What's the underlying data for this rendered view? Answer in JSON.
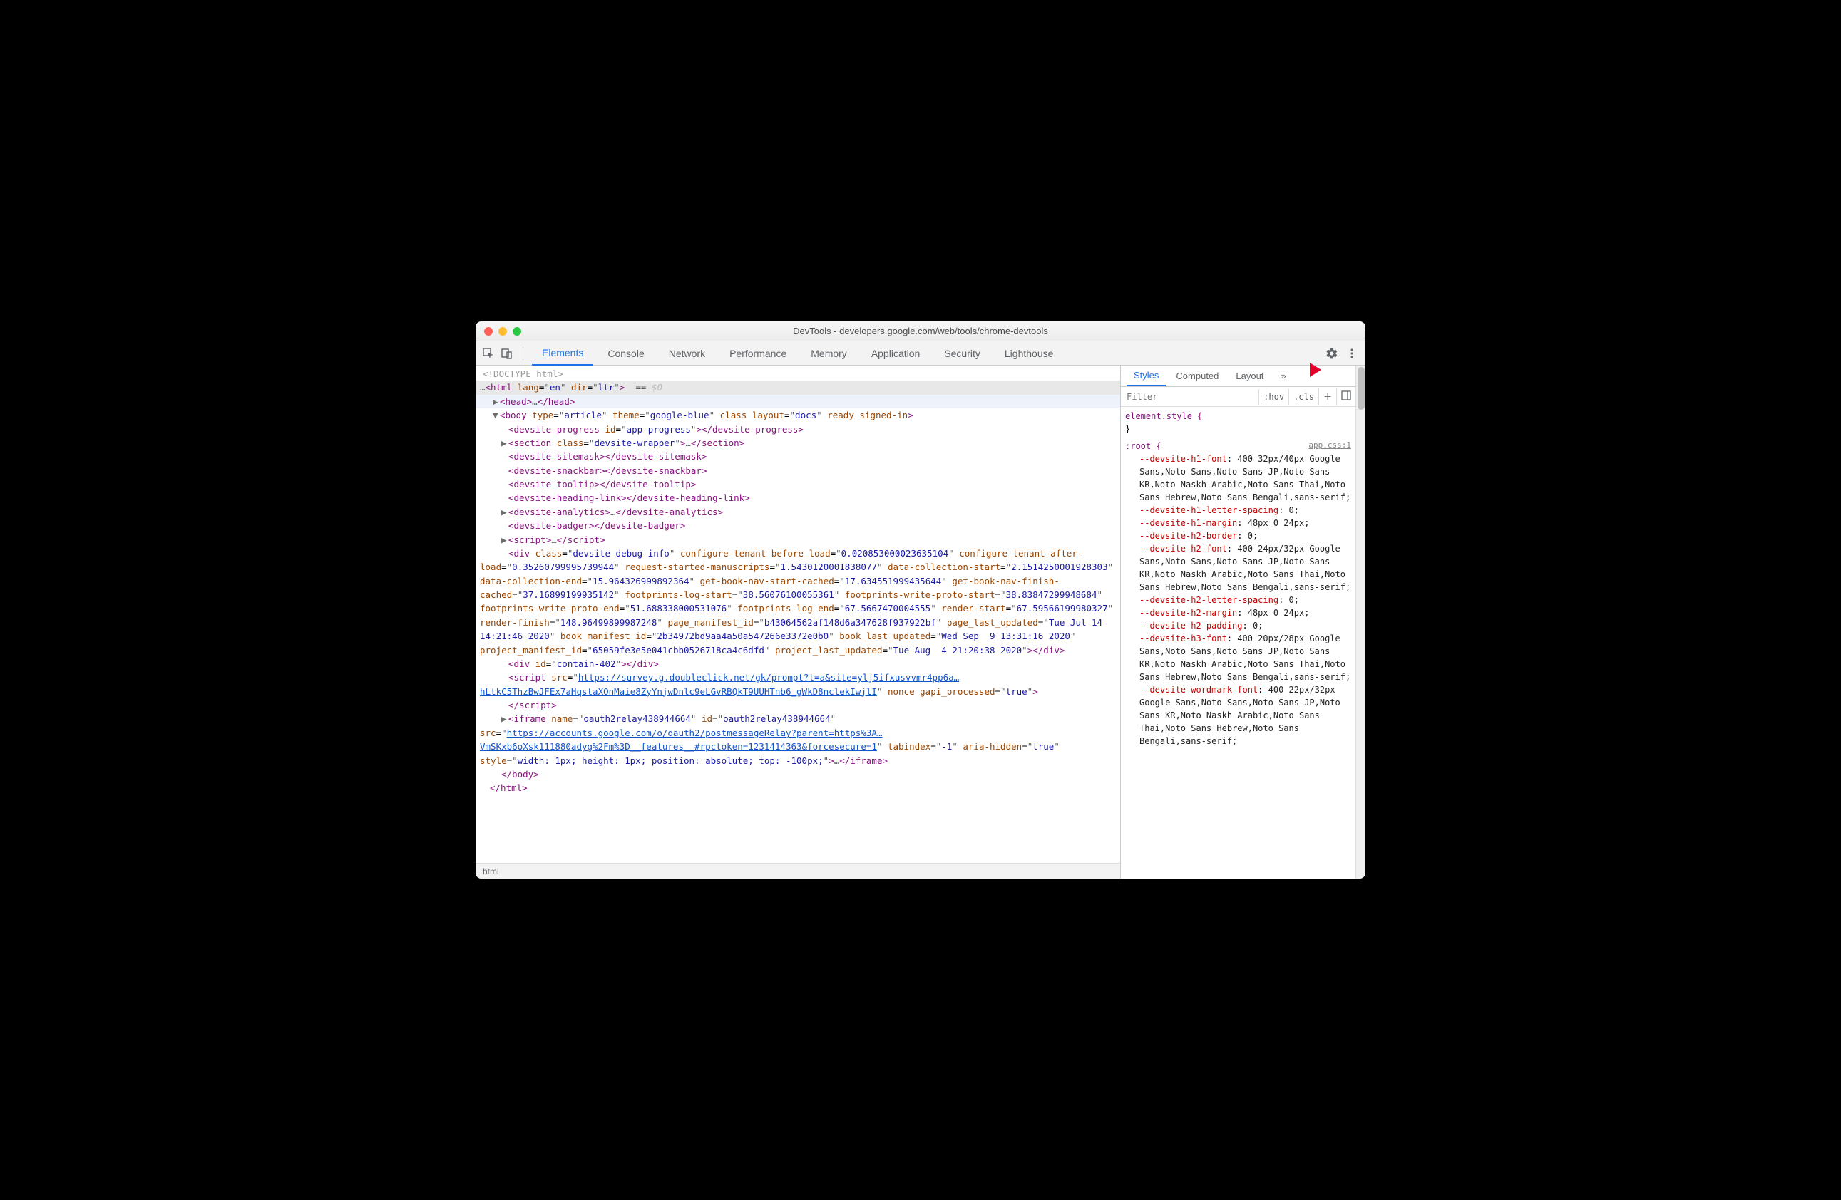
{
  "window": {
    "title": "DevTools - developers.google.com/web/tools/chrome-devtools"
  },
  "tabs": [
    "Elements",
    "Console",
    "Network",
    "Performance",
    "Memory",
    "Application",
    "Security",
    "Lighthouse"
  ],
  "activeTab": "Elements",
  "stylesTabs": [
    "Styles",
    "Computed",
    "Layout"
  ],
  "activeStylesTab": "Styles",
  "filterPlaceholder": "Filter",
  "hov": ":hov",
  "cls": ".cls",
  "breadcrumb": "html",
  "dom": {
    "doctype": "<!DOCTYPE html>",
    "htmlOpen": {
      "pre": "…",
      "tag": "html",
      "attrs": [
        [
          "lang",
          "en"
        ],
        [
          "dir",
          "ltr"
        ]
      ],
      "after": " == ",
      "dollar": "$0"
    },
    "head": {
      "open": "head",
      "ellipsis": "…",
      "close": "head"
    },
    "bodyOpen": {
      "tag": "body",
      "attrs": [
        [
          "type",
          "article"
        ],
        [
          "theme",
          "google-blue"
        ],
        [
          "class",
          ""
        ],
        [
          "layout",
          "docs"
        ],
        [
          "ready",
          ""
        ],
        [
          "signed-in",
          ""
        ]
      ]
    },
    "devsiteProgress": {
      "tag": "devsite-progress",
      "attrs": [
        [
          "id",
          "app-progress"
        ]
      ]
    },
    "sectionWrapper": {
      "tag": "section",
      "attrs": [
        [
          "class",
          "devsite-wrapper"
        ]
      ],
      "ellipsis": "…"
    },
    "sitemask": "devsite-sitemask",
    "snackbar": "devsite-snackbar",
    "tooltip": "devsite-tooltip",
    "headingLink": "devsite-heading-link",
    "analytics": {
      "tag": "devsite-analytics",
      "ellipsis": "…"
    },
    "badger": "devsite-badger",
    "script1": {
      "tag": "script",
      "ellipsis": "…"
    },
    "debugDiv": {
      "tag": "div",
      "attrs": [
        [
          "class",
          "devsite-debug-info"
        ],
        [
          "configure-tenant-before-load",
          "0.020853000023635104"
        ],
        [
          "configure-tenant-after-load",
          "0.35260799995739944"
        ],
        [
          "request-started-manuscripts",
          "1.5430120001838077"
        ],
        [
          "data-collection-start",
          "2.1514250001928303"
        ],
        [
          "data-collection-end",
          "15.964326999892364"
        ],
        [
          "get-book-nav-start-cached",
          "17.634551999435644"
        ],
        [
          "get-book-nav-finish-cached",
          "37.16899199935142"
        ],
        [
          "footprints-log-start",
          "38.56076100055361"
        ],
        [
          "footprints-write-proto-start",
          "38.83847299948684"
        ],
        [
          "footprints-write-proto-end",
          "51.688338000531076"
        ],
        [
          "footprints-log-end",
          "67.5667470004555"
        ],
        [
          "render-start",
          "67.59566199980327"
        ],
        [
          "render-finish",
          "148.96499899987248"
        ],
        [
          "page_manifest_id",
          "b43064562af148d6a347628f937922bf"
        ],
        [
          "page_last_updated",
          "Tue Jul 14 14:21:46 2020"
        ],
        [
          "book_manifest_id",
          "2b34972bd9aa4a50a547266e3372e0b0"
        ],
        [
          "book_last_updated",
          "Wed Sep  9 13:31:16 2020"
        ],
        [
          "project_manifest_id",
          "65059fe3e5e041cbb0526718ca4c6dfd"
        ],
        [
          "project_last_updated",
          "Tue Aug  4 21:20:38 2020"
        ]
      ]
    },
    "contain402": {
      "tag": "div",
      "attrs": [
        [
          "id",
          "contain-402"
        ]
      ]
    },
    "surveyScript": {
      "tag": "script",
      "src": "https://survey.g.doubleclick.net/gk/prompt?t=a&site=ylj5ifxusvvmr4pp6a…hLtkC5ThzBwJFEx7aHqstaXOnMaie8ZyYnjwDnlc9eLGvRBQkT9UUHTnb6_gWkD8nclekIwjlI",
      "attrs_after": [
        [
          "nonce",
          ""
        ],
        [
          "gapi_processed",
          "true"
        ]
      ]
    },
    "iframe": {
      "tag": "iframe",
      "attrs": [
        [
          "name",
          "oauth2relay438944664"
        ],
        [
          "id",
          "oauth2relay438944664"
        ]
      ],
      "src": "https://accounts.google.com/o/oauth2/postmessageRelay?parent=https%3A…VmSKxb6oXsk111880adyg%2Fm%3D__features__#rpctoken=1231414363&forcesecure=1",
      "attrs_after": [
        [
          "tabindex",
          "-1"
        ],
        [
          "aria-hidden",
          "true"
        ],
        [
          "style",
          "width: 1px; height: 1px; position: absolute; top: -100px;"
        ]
      ],
      "ellipsis": "…"
    },
    "bodyClose": "body",
    "htmlClose": "html"
  },
  "styles": {
    "elementStyle": "element.style {",
    "elementStyleClose": "}",
    "rootSelector": ":root {",
    "sourceLink": "app.css:1",
    "props": [
      {
        "name": "--devsite-h1-font",
        "value": "400 32px/40px Google Sans,Noto Sans,Noto Sans JP,Noto Sans KR,Noto Naskh Arabic,Noto Sans Thai,Noto Sans Hebrew,Noto Sans Bengali,sans-serif;"
      },
      {
        "name": "--devsite-h1-letter-spacing",
        "value": "0;"
      },
      {
        "name": "--devsite-h1-margin",
        "value": "48px 0 24px;"
      },
      {
        "name": "--devsite-h2-border",
        "value": "0;"
      },
      {
        "name": "--devsite-h2-font",
        "value": "400 24px/32px Google Sans,Noto Sans,Noto Sans JP,Noto Sans KR,Noto Naskh Arabic,Noto Sans Thai,Noto Sans Hebrew,Noto Sans Bengali,sans-serif;"
      },
      {
        "name": "--devsite-h2-letter-spacing",
        "value": "0;"
      },
      {
        "name": "--devsite-h2-margin",
        "value": "48px 0 24px;"
      },
      {
        "name": "--devsite-h2-padding",
        "value": "0;"
      },
      {
        "name": "--devsite-h3-font",
        "value": "400 20px/28px Google Sans,Noto Sans,Noto Sans JP,Noto Sans KR,Noto Naskh Arabic,Noto Sans Thai,Noto Sans Hebrew,Noto Sans Bengali,sans-serif;"
      },
      {
        "name": "--devsite-wordmark-font",
        "value": "400 22px/32px Google Sans,Noto Sans,Noto Sans JP,Noto Sans KR,Noto Naskh Arabic,Noto Sans Thai,Noto Sans Hebrew,Noto Sans Bengali,sans-serif;"
      }
    ]
  }
}
